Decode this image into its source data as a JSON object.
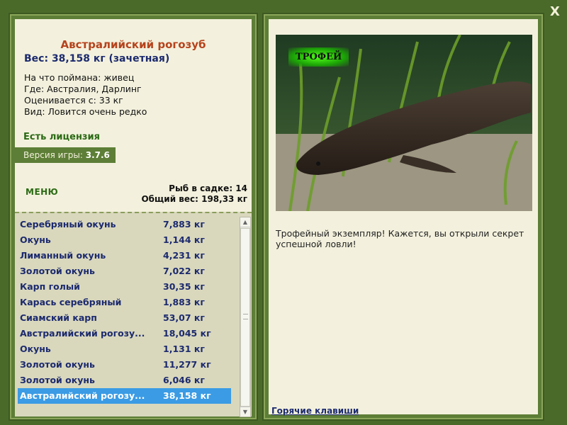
{
  "window": {
    "close_label": "X"
  },
  "fish": {
    "title": "Австралийский рогозуб",
    "weight_line": "Вес: 38,158 кг (зачетная)",
    "caught_on": "На что поймана: живец",
    "location": "Где: Австралия, Дарлинг",
    "rated_from": "Оценивается с: 33 кг",
    "rarity": "Вид: Ловится очень редко"
  },
  "license": "Есть лицензия",
  "version": {
    "label": "Версия игры:",
    "value": "3.7.6"
  },
  "menu_label": "МЕНЮ",
  "stats": {
    "in_cage": "Рыб в садке: 14",
    "total_weight": "Общий вес: 198,33 кг"
  },
  "catch_list": [
    {
      "name": "Серебряный окунь",
      "weight": "7,883 кг"
    },
    {
      "name": "Окунь",
      "weight": "1,144 кг"
    },
    {
      "name": "Лиманный окунь",
      "weight": "4,231 кг"
    },
    {
      "name": "Золотой окунь",
      "weight": "7,022 кг"
    },
    {
      "name": "Карп голый",
      "weight": "30,35 кг"
    },
    {
      "name": "Карась серебряный",
      "weight": "1,883 кг"
    },
    {
      "name": "Сиамский карп",
      "weight": "53,07 кг"
    },
    {
      "name": "Австралийский рогозу...",
      "weight": "18,045 кг"
    },
    {
      "name": "Окунь",
      "weight": "1,131 кг"
    },
    {
      "name": "Золотой окунь",
      "weight": "11,277 кг"
    },
    {
      "name": "Золотой окунь",
      "weight": "6,046 кг"
    },
    {
      "name": "Австралийский рогозу...",
      "weight": "38,158 кг",
      "selected": true
    }
  ],
  "trophy_badge": "ТРОФЕЙ",
  "description": "Трофейный экземпляр! Кажется, вы открыли секрет успешной ловли!",
  "hotkeys_label": "Горячие клавиши",
  "colors": {
    "frame": "#5d7e36",
    "panel": "#f3f1dd",
    "title": "#b6431c",
    "link": "#1c2a6e",
    "selection": "#3b9be4"
  }
}
